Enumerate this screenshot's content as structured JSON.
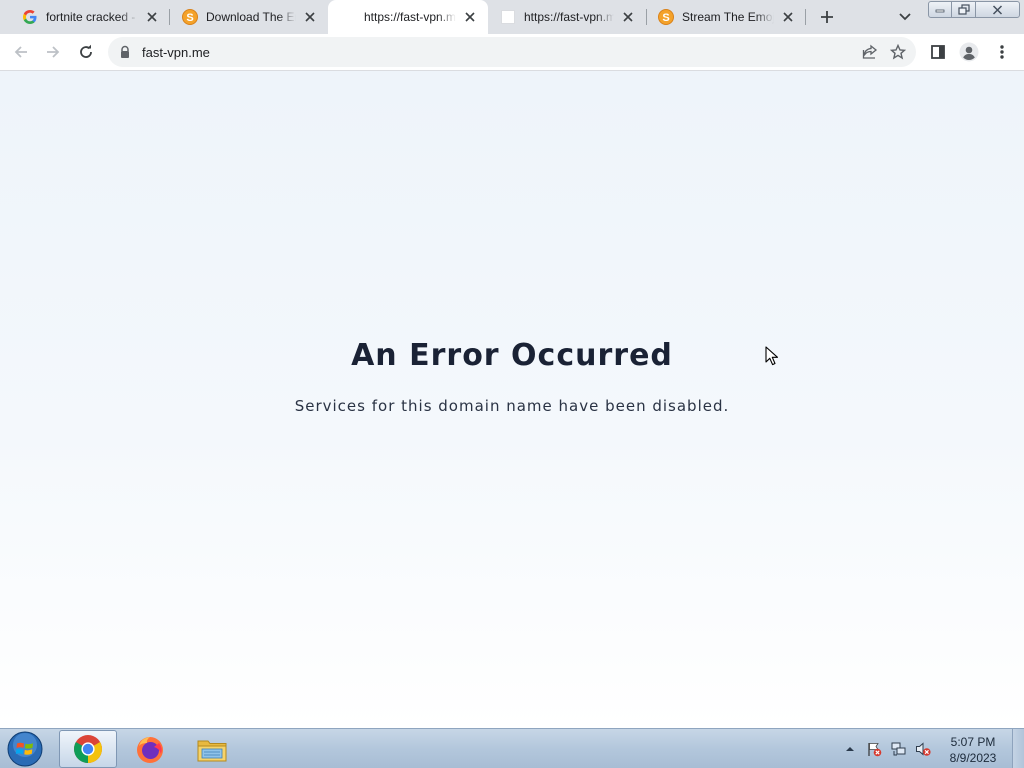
{
  "tabs": [
    {
      "title": "fortnite cracked -",
      "favicon": "google-icon",
      "active": false
    },
    {
      "title": "Download The En",
      "favicon": "s-site-icon",
      "active": false
    },
    {
      "title": "https://fast-vpn.m",
      "favicon": "blank-page-icon",
      "active": true
    },
    {
      "title": "https://fast-vpn.m",
      "favicon": "blank-page-icon",
      "active": false
    },
    {
      "title": "Stream The Emoji",
      "favicon": "s-site-icon",
      "active": false
    }
  ],
  "address_bar": {
    "url": "fast-vpn.me"
  },
  "page": {
    "heading": "An Error Occurred",
    "message": "Services for this domain name have been disabled."
  },
  "taskbar": {
    "apps": [
      "chrome-icon",
      "firefox-icon",
      "file-explorer-icon"
    ],
    "clock": {
      "time": "5:07 PM",
      "date": "8/9/2023"
    }
  },
  "colors": {
    "heading": "#1a2235",
    "tabstrip": "#dee1e6",
    "page_top": "#eef4fa"
  }
}
